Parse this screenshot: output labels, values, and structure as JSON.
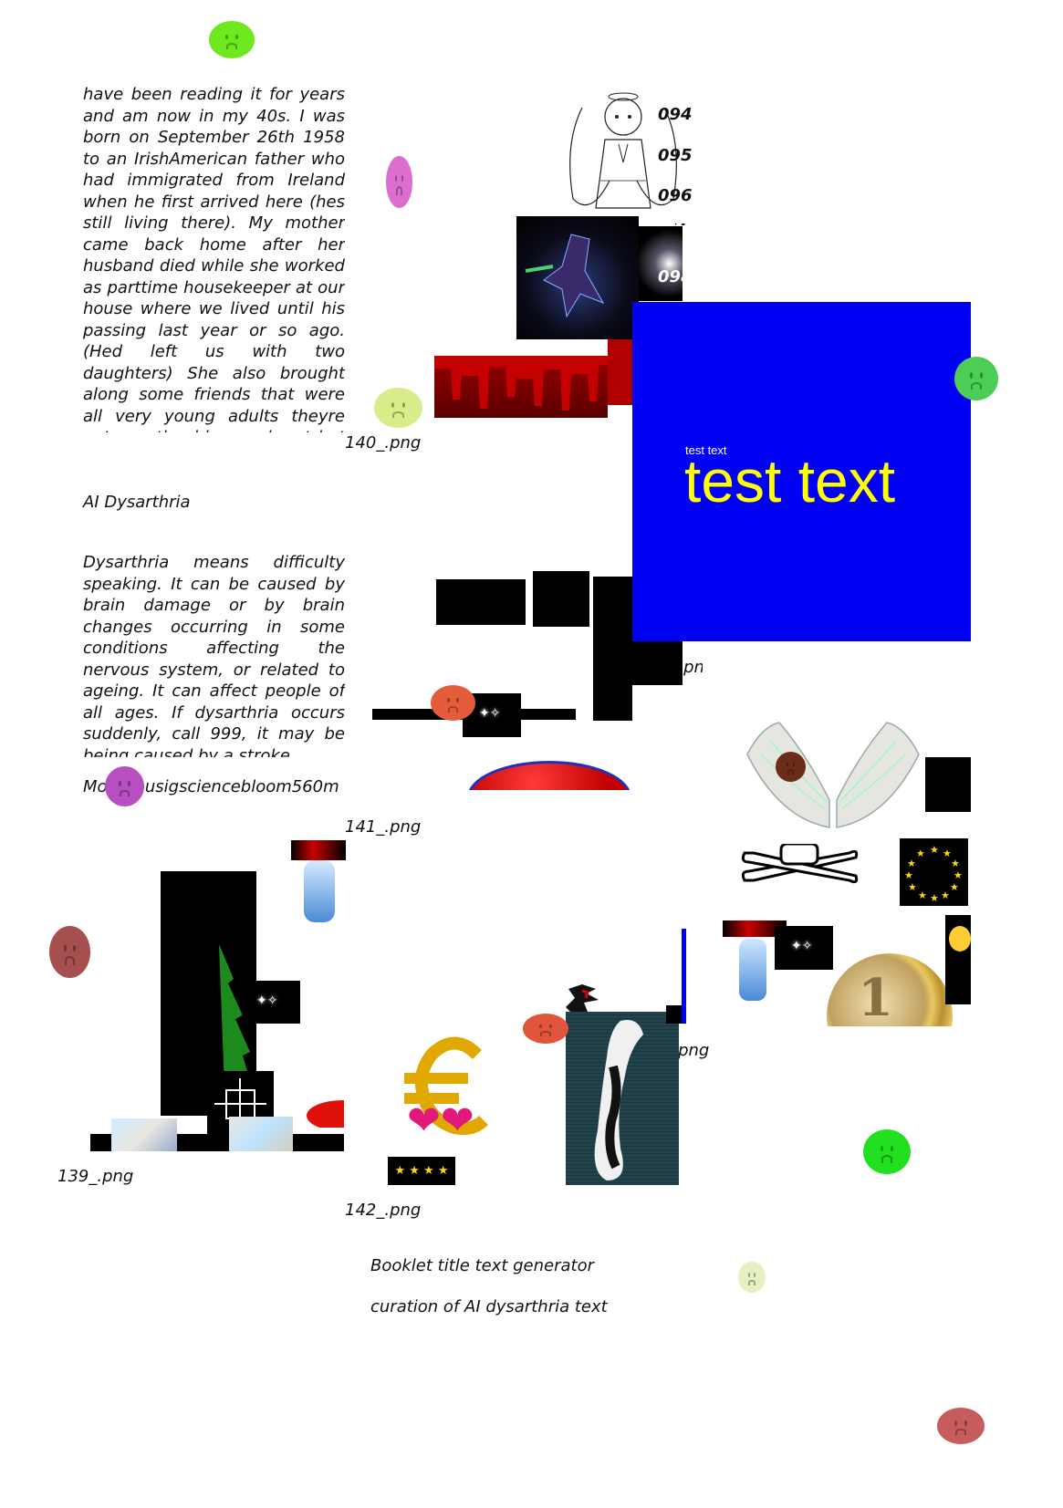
{
  "paragraph_1": "have been reading it for years and am now in my 40s. I was born on September 26th 1958 to an IrishAmerican father who had immigrated from Ireland when he first arrived here (hes still living there). My mother came back home after her husband died while she worked as parttime housekeeper at our house where we lived until his passing last year or so ago. (Hed left us with two daughters) She also brought along some friends that were all very young adults theyre not exactly old enough yet but are pretty much readytogo parents",
  "heading": "AI Dysarthria",
  "paragraph_2": "Dysarthria means difficulty speaking. It can be caused by brain damage or by brain changes occurring in some conditions affecting the nervous system, or related to ageing. It can affect people of all ages. If dysarthria occurs suddenly, call 999, it may be being caused by a stroke.",
  "credit": "Morpheusigsciencebloom560m",
  "captions": {
    "c140": "140_.png",
    "c141": "141_.png",
    "c139": "139_.png",
    "c142": "142_.png",
    "c144": "144_.png",
    "c143": "143_.png"
  },
  "angel_numbers": [
    "094",
    "095",
    "096",
    "097",
    "098"
  ],
  "blue_panel": {
    "small_text": "test text",
    "big_text": "test text",
    "background": "#0000f5",
    "text_color": "#ffff00"
  },
  "footer_lines": [
    "Booklet title text generator",
    "curation of AI dysarthria text"
  ],
  "icons": [
    "sad-face-icon",
    "angel-drawing",
    "dark-knight-sprite",
    "skull-crossbones-icon",
    "angel-wings-image",
    "euro-flag-icon",
    "euro-coin-image",
    "euro-sign-icon",
    "hearts-icon",
    "screaming-emoji-icon",
    "shadow-hedgehog-sprite",
    "anime-girl-sprite"
  ],
  "colors": {
    "face_green": "#6ee81f",
    "face_pink": "#dd6ecf",
    "face_lime": "#d8ec8a",
    "face_green2": "#4ccd55",
    "face_orange": "#e45c3a",
    "face_purple": "#b64fbf",
    "face_brown": "#a64f4f",
    "face_red": "#e2543c",
    "face_bright_green": "#22e020",
    "face_pale": "#e4f0c0",
    "face_dark_brown": "#6b2c1a",
    "face_rose": "#c75c5c"
  }
}
